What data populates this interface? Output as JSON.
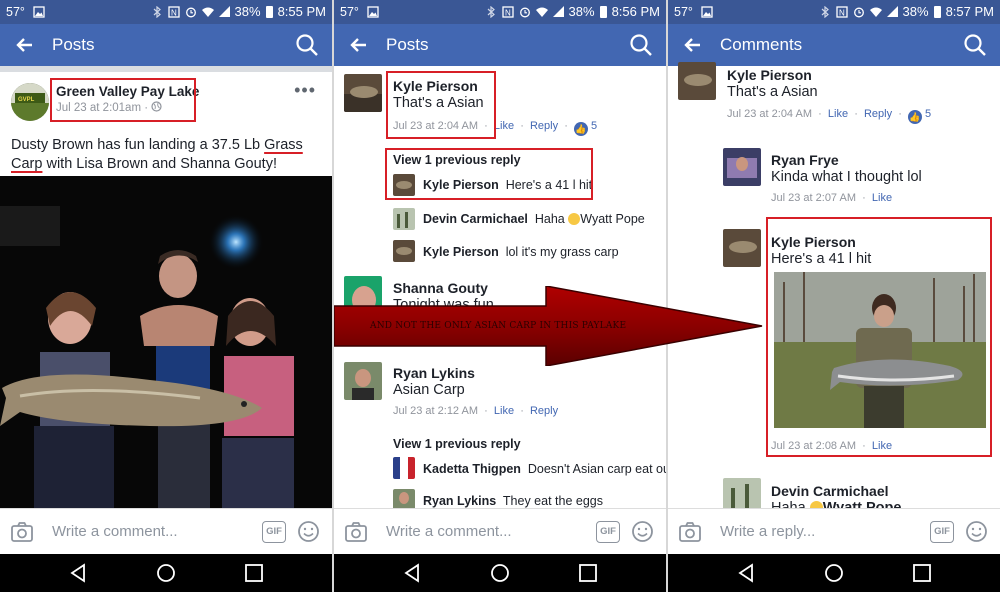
{
  "status_bars": [
    {
      "temp": "57°",
      "battery": "38%",
      "time": "8:55 PM"
    },
    {
      "temp": "57°",
      "battery": "38%",
      "time": "8:56 PM"
    },
    {
      "temp": "57°",
      "battery": "38%",
      "time": "8:57 PM"
    }
  ],
  "panel1": {
    "title": "Posts",
    "page_name": "Green Valley Pay Lake",
    "timestamp": "Jul 23 at 2:01am",
    "text_before": "Dusty Brown has fun landing a 37.5 Lb ",
    "text_grass": "Grass",
    "text_carp": "Carp",
    "text_after": " with Lisa Brown and Shanna Gouty!",
    "input_placeholder": "Write a comment...",
    "gif_label": "GIF"
  },
  "panel2": {
    "title": "Posts",
    "c1": {
      "name": "Kyle Pierson",
      "text": "That's a Asian",
      "time": "Jul 23 at 2:04 AM",
      "like": "Like",
      "reply": "Reply",
      "reactions": "5"
    },
    "view_prev_1": "View 1 previous reply",
    "r1": {
      "name": "Kyle Pierson",
      "text": "Here's a 41 l hit"
    },
    "r2": {
      "name": "Devin Carmichael",
      "text": "Haha",
      "mention": "Wyatt Pope"
    },
    "r3": {
      "name": "Kyle Pierson",
      "text": "lol it's my grass carp"
    },
    "c2": {
      "name": "Shanna Gouty",
      "text": "Tonight was fun"
    },
    "c3": {
      "name": "Ryan Lykins",
      "text": "Asian Carp",
      "time": "Jul 23 at 2:12 AM",
      "like": "Like",
      "reply": "Reply"
    },
    "view_prev_2": "View 1 previous reply",
    "r4": {
      "name": "Kadetta Thigpen",
      "text": "Doesn't Asian carp eat ou..."
    },
    "r5": {
      "name": "Ryan Lykins",
      "text": "They eat the eggs"
    },
    "input_placeholder": "Write a comment...",
    "gif_label": "GIF"
  },
  "arrow_text": "AND NOT THE ONLY ASIAN CARP IN THIS PAYLAKE",
  "panel3": {
    "title": "Comments",
    "c1": {
      "name": "Kyle Pierson",
      "text": "That's a Asian",
      "time": "Jul 23 at 2:04 AM",
      "like": "Like",
      "reply": "Reply",
      "reactions": "5"
    },
    "c2": {
      "name": "Ryan Frye",
      "text": "Kinda what I thought lol",
      "time": "Jul 23 at 2:07 AM",
      "like": "Like"
    },
    "c3": {
      "name": "Kyle Pierson",
      "text": "Here's a 41 l hit",
      "time": "Jul 23 at 2:08 AM",
      "like": "Like"
    },
    "c4": {
      "name": "Devin Carmichael",
      "text": "Haha",
      "mention": "Wyatt Pope"
    },
    "input_placeholder": "Write a reply...",
    "gif_label": "GIF"
  },
  "colors": {
    "fb_blue": "#4267b2",
    "status_blue": "#3a5795",
    "highlight_red": "#d71f26",
    "arrow_red": "#8b0000"
  }
}
